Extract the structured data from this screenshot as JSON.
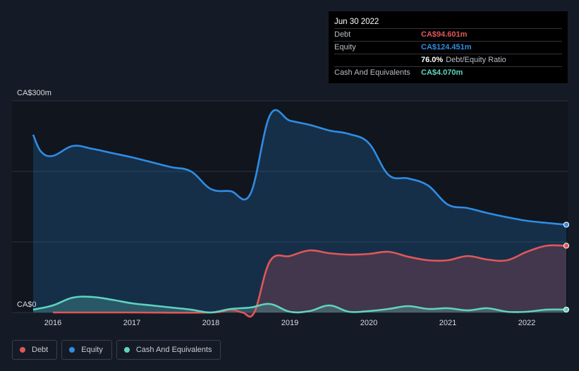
{
  "tooltip": {
    "date": "Jun 30 2022",
    "rows": [
      {
        "label": "Debt",
        "value": "CA$94.601m",
        "color": "#e15759"
      },
      {
        "label": "Equity",
        "value": "CA$124.451m",
        "color": "#2f8de4"
      },
      {
        "label": "",
        "value": "76.0%",
        "sub": "Debt/Equity Ratio",
        "color": "#ffffff"
      },
      {
        "label": "Cash And Equivalents",
        "value": "CA$4.070m",
        "color": "#5fd3c0"
      }
    ]
  },
  "legend": [
    {
      "label": "Debt",
      "color": "#e15759"
    },
    {
      "label": "Equity",
      "color": "#2f8de4"
    },
    {
      "label": "Cash And Equivalents",
      "color": "#5fd3c0"
    }
  ],
  "chart_data": {
    "type": "area",
    "y_tick_labels": [
      "CA$300m",
      "CA$0"
    ],
    "ylim": [
      0,
      300
    ],
    "xlim": [
      2015.75,
      2022.5
    ],
    "x_tick_labels": [
      "2016",
      "2017",
      "2018",
      "2019",
      "2020",
      "2021",
      "2022"
    ],
    "grid": true,
    "legend_position": "bottom-left",
    "series": [
      {
        "name": "Equity",
        "color": "#2f8de4",
        "points": [
          [
            2015.75,
            252
          ],
          [
            2015.85,
            228
          ],
          [
            2016.0,
            222
          ],
          [
            2016.25,
            236
          ],
          [
            2016.5,
            232
          ],
          [
            2016.75,
            226
          ],
          [
            2017.0,
            220
          ],
          [
            2017.25,
            213
          ],
          [
            2017.5,
            206
          ],
          [
            2017.75,
            200
          ],
          [
            2018.0,
            175
          ],
          [
            2018.25,
            172
          ],
          [
            2018.5,
            168
          ],
          [
            2018.75,
            280
          ],
          [
            2019.0,
            272
          ],
          [
            2019.25,
            266
          ],
          [
            2019.5,
            258
          ],
          [
            2019.75,
            253
          ],
          [
            2020.0,
            240
          ],
          [
            2020.25,
            195
          ],
          [
            2020.5,
            190
          ],
          [
            2020.75,
            180
          ],
          [
            2021.0,
            153
          ],
          [
            2021.25,
            148
          ],
          [
            2021.5,
            141
          ],
          [
            2021.75,
            135
          ],
          [
            2022.0,
            130
          ],
          [
            2022.25,
            127
          ],
          [
            2022.5,
            124.451
          ]
        ]
      },
      {
        "name": "Debt",
        "color": "#e15759",
        "points": [
          [
            2016.0,
            0
          ],
          [
            2017.0,
            0
          ],
          [
            2018.0,
            0
          ],
          [
            2018.25,
            4
          ],
          [
            2018.4,
            0
          ],
          [
            2018.55,
            0
          ],
          [
            2018.75,
            73
          ],
          [
            2019.0,
            80
          ],
          [
            2019.25,
            88
          ],
          [
            2019.5,
            84
          ],
          [
            2019.75,
            82
          ],
          [
            2020.0,
            83
          ],
          [
            2020.25,
            86
          ],
          [
            2020.5,
            79
          ],
          [
            2020.75,
            74
          ],
          [
            2021.0,
            74
          ],
          [
            2021.25,
            80
          ],
          [
            2021.5,
            75
          ],
          [
            2021.75,
            74
          ],
          [
            2022.0,
            86
          ],
          [
            2022.25,
            94.6
          ],
          [
            2022.5,
            94.601
          ]
        ]
      },
      {
        "name": "Cash And Equivalents",
        "color": "#5fd3c0",
        "points": [
          [
            2015.75,
            4
          ],
          [
            2016.0,
            10
          ],
          [
            2016.25,
            21
          ],
          [
            2016.5,
            22
          ],
          [
            2016.75,
            18
          ],
          [
            2017.0,
            13
          ],
          [
            2017.25,
            10
          ],
          [
            2017.5,
            7
          ],
          [
            2017.75,
            4
          ],
          [
            2018.0,
            0
          ],
          [
            2018.25,
            5
          ],
          [
            2018.5,
            7
          ],
          [
            2018.75,
            12
          ],
          [
            2019.0,
            1
          ],
          [
            2019.25,
            2
          ],
          [
            2019.5,
            10
          ],
          [
            2019.75,
            1
          ],
          [
            2020.0,
            2
          ],
          [
            2020.25,
            5
          ],
          [
            2020.5,
            9
          ],
          [
            2020.75,
            5
          ],
          [
            2021.0,
            6
          ],
          [
            2021.25,
            3
          ],
          [
            2021.5,
            6
          ],
          [
            2021.75,
            1
          ],
          [
            2022.0,
            1
          ],
          [
            2022.25,
            4
          ],
          [
            2022.5,
            4.07
          ]
        ]
      }
    ]
  }
}
